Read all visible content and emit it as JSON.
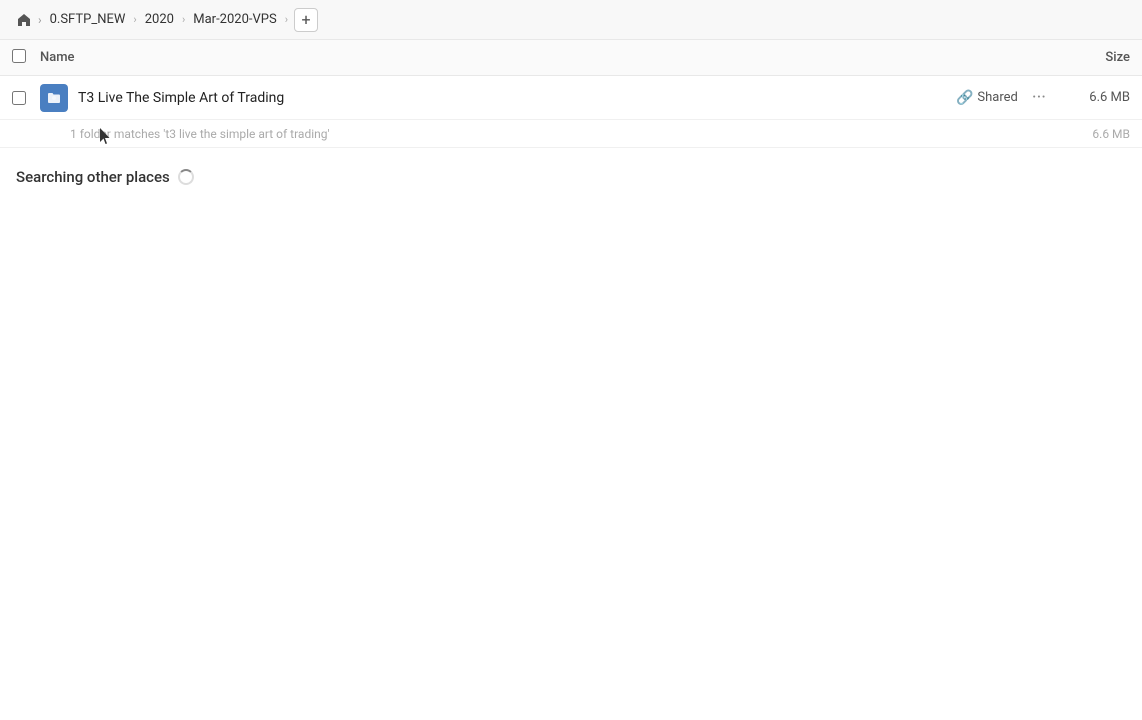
{
  "breadcrumb": {
    "home_icon": "🏠",
    "items": [
      {
        "label": "0.SFTP_NEW"
      },
      {
        "label": "2020"
      },
      {
        "label": "Mar-2020-VPS"
      }
    ],
    "add_label": "+"
  },
  "table": {
    "header": {
      "name_label": "Name",
      "size_label": "Size"
    },
    "rows": [
      {
        "name": "T3 Live The Simple Art of Trading",
        "shared_label": "Shared",
        "size": "6.6 MB",
        "match_text": "1 folder matches 't3 live the simple art of trading'",
        "match_size": "6.6 MB"
      }
    ]
  },
  "searching": {
    "label": "Searching other places"
  }
}
